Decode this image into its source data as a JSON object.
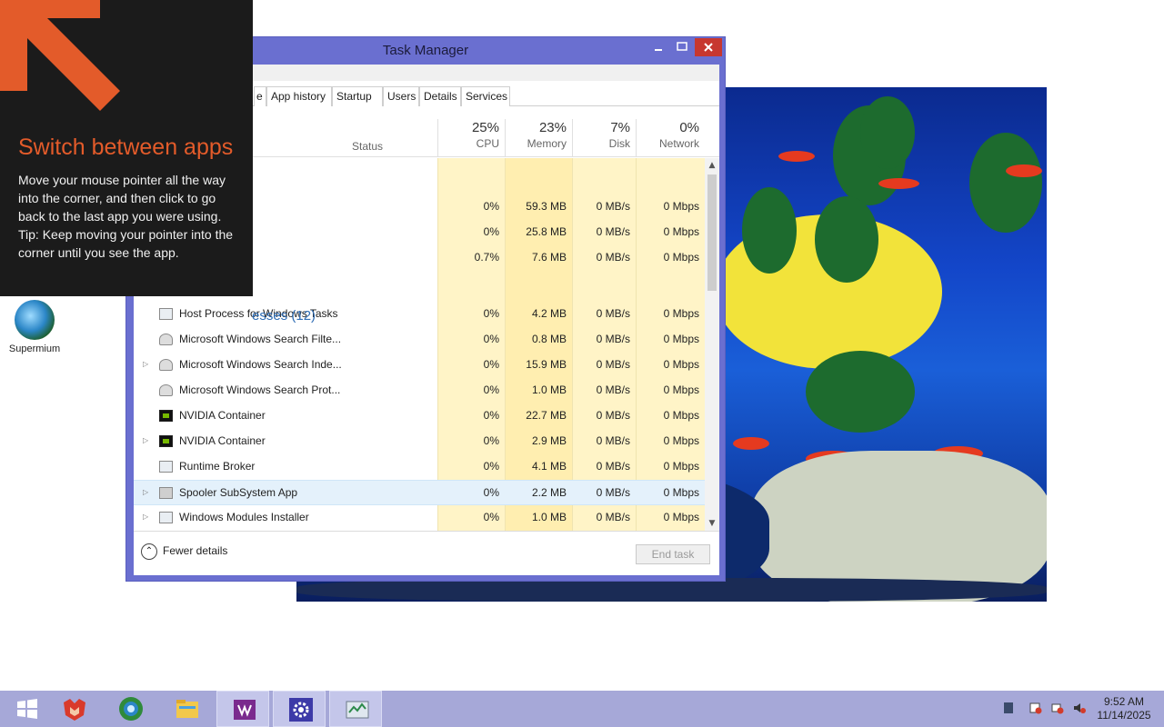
{
  "desktop": {
    "icon_label": "Supermium"
  },
  "tip": {
    "title": "Switch between apps",
    "body_line1": "Move your mouse pointer all the way into the corner, and then click to go back to the last app you were using.",
    "body_line2": "Tip: Keep moving your pointer into the corner until you see the app.",
    "accent_color": "#e35b2a"
  },
  "task_manager": {
    "title": "Task Manager",
    "tabs": [
      {
        "label": "e"
      },
      {
        "label": "App history"
      },
      {
        "label": "Startup"
      },
      {
        "label": "Users"
      },
      {
        "label": "Details"
      },
      {
        "label": "Services"
      }
    ],
    "columns": {
      "status": "Status",
      "cpu": {
        "pct": "25%",
        "label": "CPU"
      },
      "memory": {
        "pct": "23%",
        "label": "Memory"
      },
      "disk": {
        "pct": "7%",
        "label": "Disk"
      },
      "network": {
        "pct": "0%",
        "label": "Network"
      }
    },
    "top_rows": [
      {
        "cpu": "0%",
        "memory": "59.3 MB",
        "disk": "0 MB/s",
        "network": "0 Mbps"
      },
      {
        "cpu": "0%",
        "memory": "25.8 MB",
        "disk": "0 MB/s",
        "network": "0 Mbps"
      },
      {
        "cpu": "0.7%",
        "memory": "7.6 MB",
        "disk": "0 MB/s",
        "network": "0 Mbps"
      }
    ],
    "group_label": "esses (12)",
    "processes": [
      {
        "name": "Host Process for Windows Tasks",
        "expand": "",
        "icon": "window",
        "cpu": "0%",
        "memory": "4.2 MB",
        "disk": "0 MB/s",
        "network": "0 Mbps"
      },
      {
        "name": "Microsoft Windows Search Filte...",
        "expand": "",
        "icon": "search",
        "cpu": "0%",
        "memory": "0.8 MB",
        "disk": "0 MB/s",
        "network": "0 Mbps"
      },
      {
        "name": "Microsoft Windows Search Inde...",
        "expand": "▷",
        "icon": "search",
        "cpu": "0%",
        "memory": "15.9 MB",
        "disk": "0 MB/s",
        "network": "0 Mbps"
      },
      {
        "name": "Microsoft Windows Search Prot...",
        "expand": "",
        "icon": "search",
        "cpu": "0%",
        "memory": "1.0 MB",
        "disk": "0 MB/s",
        "network": "0 Mbps"
      },
      {
        "name": "NVIDIA Container",
        "expand": "",
        "icon": "nvidia",
        "cpu": "0%",
        "memory": "22.7 MB",
        "disk": "0 MB/s",
        "network": "0 Mbps"
      },
      {
        "name": "NVIDIA Container",
        "expand": "▷",
        "icon": "nvidia",
        "cpu": "0%",
        "memory": "2.9 MB",
        "disk": "0 MB/s",
        "network": "0 Mbps"
      },
      {
        "name": "Runtime Broker",
        "expand": "",
        "icon": "window",
        "cpu": "0%",
        "memory": "4.1 MB",
        "disk": "0 MB/s",
        "network": "0 Mbps"
      },
      {
        "name": "Spooler SubSystem App",
        "expand": "▷",
        "icon": "printer",
        "cpu": "0%",
        "memory": "2.2 MB",
        "disk": "0 MB/s",
        "network": "0 Mbps"
      },
      {
        "name": "Windows Modules Installer",
        "expand": "▷",
        "icon": "window",
        "cpu": "0%",
        "memory": "1.0 MB",
        "disk": "0 MB/s",
        "network": "0 Mbps"
      }
    ],
    "footer": {
      "fewer_details": "Fewer details",
      "end_task": "End task"
    }
  },
  "taskbar": {
    "apps": [
      "start",
      "gitkraken",
      "supermium",
      "file-explorer",
      "onenote",
      "settings",
      "photos"
    ],
    "clock_time": "9:52 AM",
    "clock_date": "11/14/2025"
  }
}
